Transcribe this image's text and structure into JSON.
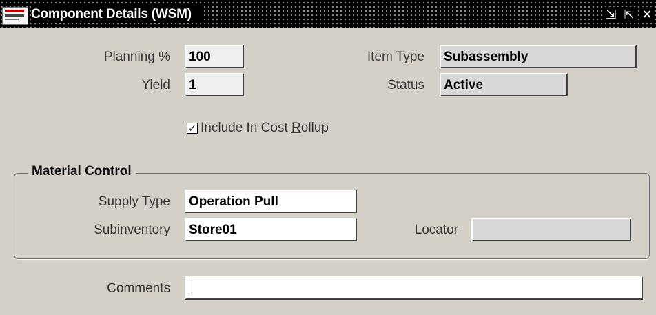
{
  "window": {
    "title": "Component Details (WSM)",
    "logo": "oracle-applications-logo",
    "controls": {
      "minimize": "minimize-icon",
      "maximize": "maximize-icon",
      "close": "close-icon"
    },
    "controls_glyphs": {
      "minimize": "⇲",
      "maximize": "⇱",
      "close": "✕"
    }
  },
  "fields": {
    "planning_percent": {
      "label": "Planning %",
      "value": "100"
    },
    "yield": {
      "label": "Yield",
      "value": "1"
    },
    "item_type": {
      "label": "Item Type",
      "value": "Subassembly"
    },
    "status": {
      "label": "Status",
      "value": "Active"
    }
  },
  "include_cost_rollup": {
    "checked": true,
    "check_glyph": "✓",
    "label_before": "Include In Cost ",
    "label_mnemonic": "R",
    "label_after": "ollup"
  },
  "material_control": {
    "title": "Material Control",
    "supply_type": {
      "label": "Supply Type",
      "value": "Operation Pull"
    },
    "subinventory": {
      "label": "Subinventory",
      "value": "Store01"
    },
    "locator": {
      "label": "Locator",
      "value": ""
    }
  },
  "comments": {
    "label": "Comments",
    "value": ""
  },
  "colors": {
    "window_bg": "#d4d0c8",
    "readonly_field_bg": "#d8d8d8",
    "editable_field_bg": "#ffffff",
    "titlebar_bg": "#000000"
  }
}
